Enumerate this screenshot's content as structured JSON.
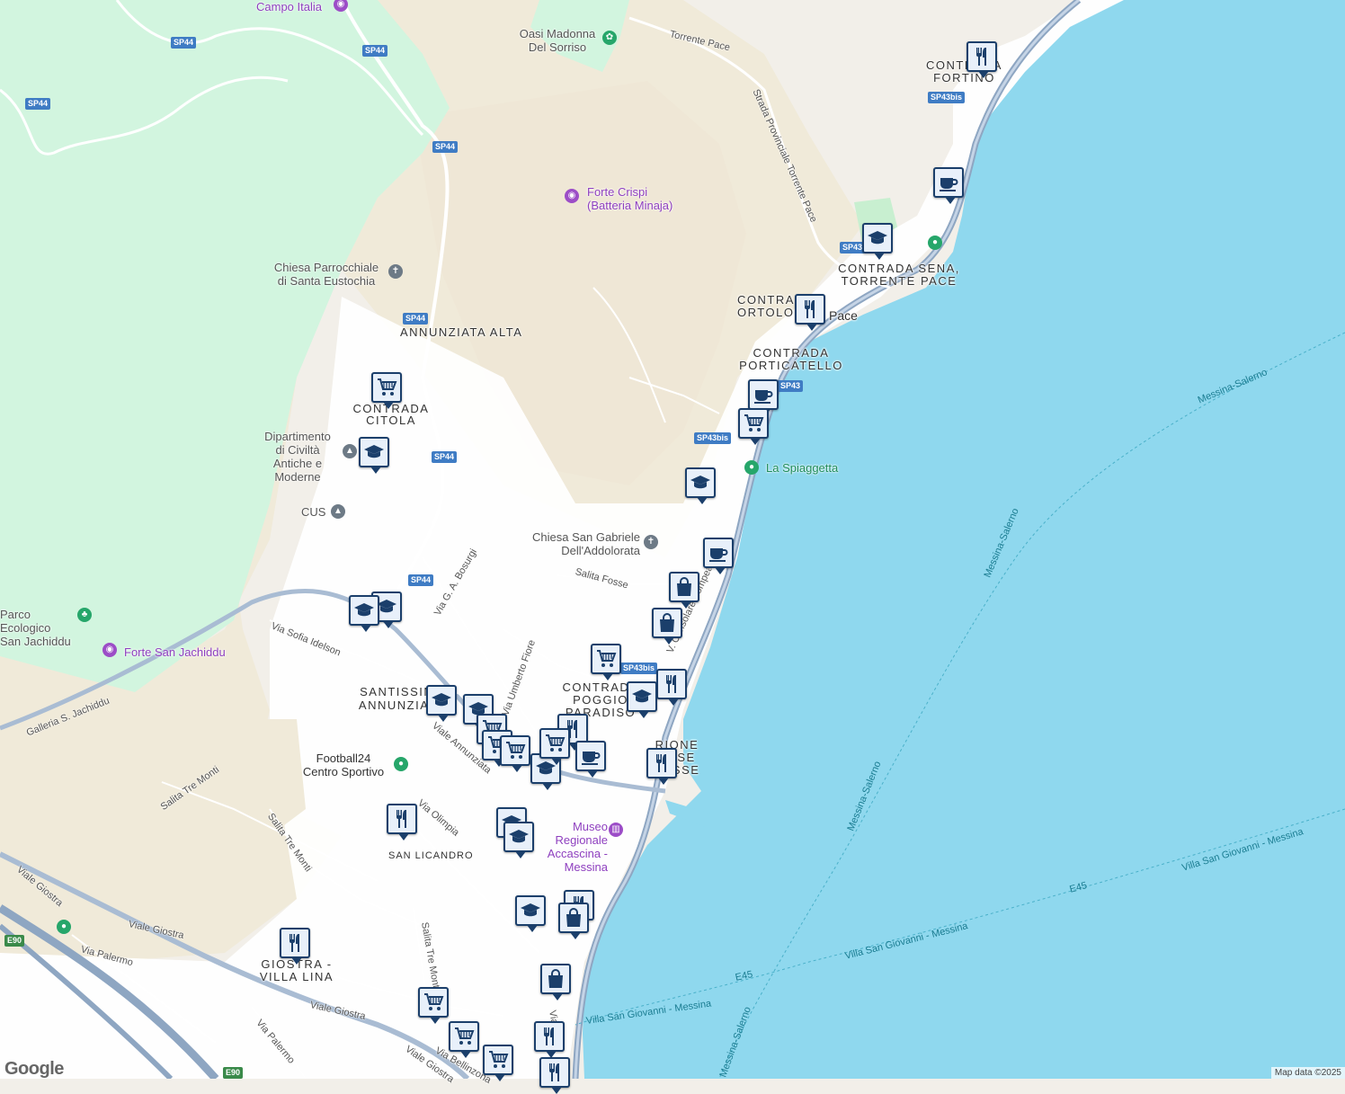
{
  "colors": {
    "sea": "#8fd8ee",
    "land": "#f2efe9",
    "park": "#d2f5df",
    "highway": "#8ea6c2",
    "road": "#ffffff",
    "pin_border": "#1b3f6b",
    "pin_fill": "#e8f0fa"
  },
  "areas": [
    "ANNUNZIATA ALTA",
    "CONTRADA CITOLA",
    "SANTISSIMA ANNUNZIATA",
    "CONTRADA POGGIO PARADISO",
    "RIONE CASE BASSE",
    "SAN LICANDRO",
    "GIOSTRA - VILLA LINA",
    "CONTRADA SENA, TORRENTE PACE",
    "CONTRADA ORTOLOGO",
    "Pace",
    "CONTRADA PORTICATELLO",
    "CONTRADA FORTINO"
  ],
  "pois": {
    "campo_italia": "Campo Italia",
    "oasi": "Oasi Madonna Del Sorriso",
    "forte_crispi": "Forte Crispi (Batteria Minaja)",
    "chiesa_eustochia": "Chiesa Parrocchiale di Santa Eustochia",
    "dipartimento": "Dipartimento di Civiltà Antiche e Moderne",
    "cus": "CUS",
    "parco": "Parco Ecologico San Jachiddu",
    "forte_jachiddu": "Forte San Jachiddu",
    "chiesa_gabriele": "Chiesa San Gabriele Dell'Addolorata",
    "spiaggetta": "La Spiaggetta",
    "football": "Football24 Centro Sportivo",
    "museo": "Museo Regionale Accascina - Messina"
  },
  "roads": {
    "torrente_pace": "Torrente Pace",
    "strada_prov": "Strada Provinciale Torrente Pace",
    "salita_fosse": "Salita Fosse",
    "bosurgi": "Via G. A. Bosurgi",
    "idelson": "Via Sofia Idelson",
    "galleria": "Galleria S. Jachiddu",
    "umberto_fiore": "Via Umberto Fiore",
    "viale_annunziata": "Viale Annunziata",
    "consolare": "V. Consolare Pompea",
    "olimpia": "Via Olimpia",
    "tre_monti1": "Salita Tre Monti",
    "tre_monti2": "Salita Tre Monti",
    "tre_monti3": "Salita Tre Monti",
    "viale_giostra1": "Viale Giostra",
    "viale_giostra2": "Viale Giostra",
    "viale_giostra3": "Viale Giostra",
    "viale_giostra4": "Viale Giostra",
    "via_palermo1": "Via Palermo",
    "via_palermo2": "Via Palermo",
    "bellinzona": "Via Bellinzona",
    "via_short": "Via"
  },
  "shields": {
    "sp44_1": "SP44",
    "sp44_2": "SP44",
    "sp44_3": "SP44",
    "sp44_4": "SP44",
    "sp44_5": "SP44",
    "sp44_6": "SP44",
    "sp44_7": "SP44",
    "sp43bis_1": "SP43bis",
    "sp43bis_2": "SP43bis",
    "sp43bis_3": "SP43bis",
    "sp43_1": "SP43",
    "sp43_2": "SP43",
    "e90_1": "E90",
    "e90_2": "E90"
  },
  "ferry": {
    "ms1": "Messina-Salerno",
    "ms2": "Messina-Salerno",
    "ms3": "Messina-Salerno",
    "ms4": "Messina-Salerno",
    "vsg1": "Villa San Giovanni - Messina",
    "vsg2": "Villa San Giovanni - Messina",
    "vsg3": "Villa San Giovanni - Messina",
    "e45_1": "E45",
    "e45_2": "E45"
  },
  "footer": {
    "google": "Google",
    "map_data": "Map data ©2025"
  }
}
